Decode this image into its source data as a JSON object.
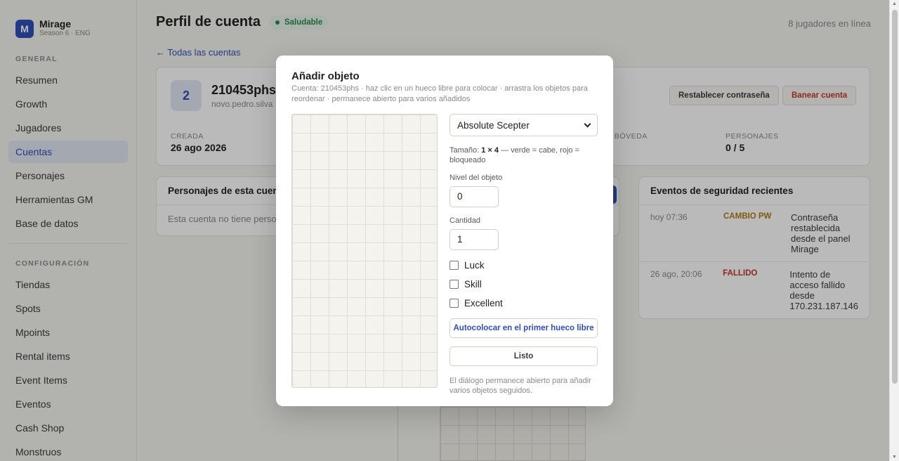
{
  "brand": {
    "logo_letter": "M",
    "name": "Mirage",
    "subtitle": "Season 6 · ENG"
  },
  "sidebar": {
    "section_general": "GENERAL",
    "general_items": [
      {
        "label": "Resumen"
      },
      {
        "label": "Growth"
      },
      {
        "label": "Jugadores"
      },
      {
        "label": "Cuentas",
        "active": true
      },
      {
        "label": "Personajes"
      },
      {
        "label": "Herramientas GM"
      },
      {
        "label": "Base de datos"
      }
    ],
    "section_config": "CONFIGURACIÓN",
    "config_items": [
      {
        "label": "Tiendas"
      },
      {
        "label": "Spots"
      },
      {
        "label": "Mpoints"
      },
      {
        "label": "Rental items"
      },
      {
        "label": "Event Items"
      },
      {
        "label": "Eventos"
      },
      {
        "label": "Cash Shop"
      },
      {
        "label": "Monstruos"
      }
    ]
  },
  "header": {
    "title": "Perfil de cuenta",
    "status_badge": "Saludable",
    "online_count": "8 jugadores en línea",
    "back_link": "← Todas las cuentas"
  },
  "account": {
    "avatar": "2",
    "name": "210453phs",
    "email": "novo.pedro.silva",
    "reset_button": "Restablecer contraseña",
    "ban_button": "Banear cuenta",
    "stats": [
      {
        "label": "CREADA",
        "value": "26 ago 2026"
      },
      {
        "label": "BÓVEDA",
        "value": ""
      },
      {
        "label": "PERSONAJES",
        "value": "0 / 5"
      }
    ]
  },
  "characters_panel": {
    "title": "Personajes de esta cuent",
    "empty": "Esta cuenta no tiene person"
  },
  "security_panel": {
    "title": "Eventos de seguridad recientes",
    "events": [
      {
        "time": "hoy 07:36",
        "tag": "CAMBIO PW",
        "tag_color": "#b07d12",
        "desc": "Contraseña restablecida desde el panel Mirage"
      },
      {
        "time": "26 ago, 20:06",
        "tag": "FALLIDO",
        "tag_color": "#c0392b",
        "desc": "Intento de acceso fallido desde 170.231.187.146"
      }
    ]
  },
  "modal": {
    "title": "Añadir objeto",
    "subtitle": "Cuenta: 210453phs · haz clic en un hueco libre para colocar · arrastra los objetos para reordenar · permanece abierto para varios añadidos",
    "item_select": "Absolute Scepter",
    "size_prefix": "Tamaño: ",
    "size_value": "1 × 4",
    "size_suffix": " — verde = cabe, rojo = bloqueado",
    "level_label": "Nivel del objeto",
    "level_value": "0",
    "quantity_label": "Cantidad",
    "quantity_value": "1",
    "options": [
      "Luck",
      "Skill",
      "Excellent"
    ],
    "autoplace_button": "Autocolocar en el primer hueco libre",
    "done_button": "Listo",
    "footnote": "El diálogo permanece abierto para añadir varios objetos seguidos."
  },
  "colors": {
    "accent": "#2f4fb8",
    "healthy": "#2d8a4e",
    "danger": "#c0392b",
    "warning": "#b07d12"
  }
}
